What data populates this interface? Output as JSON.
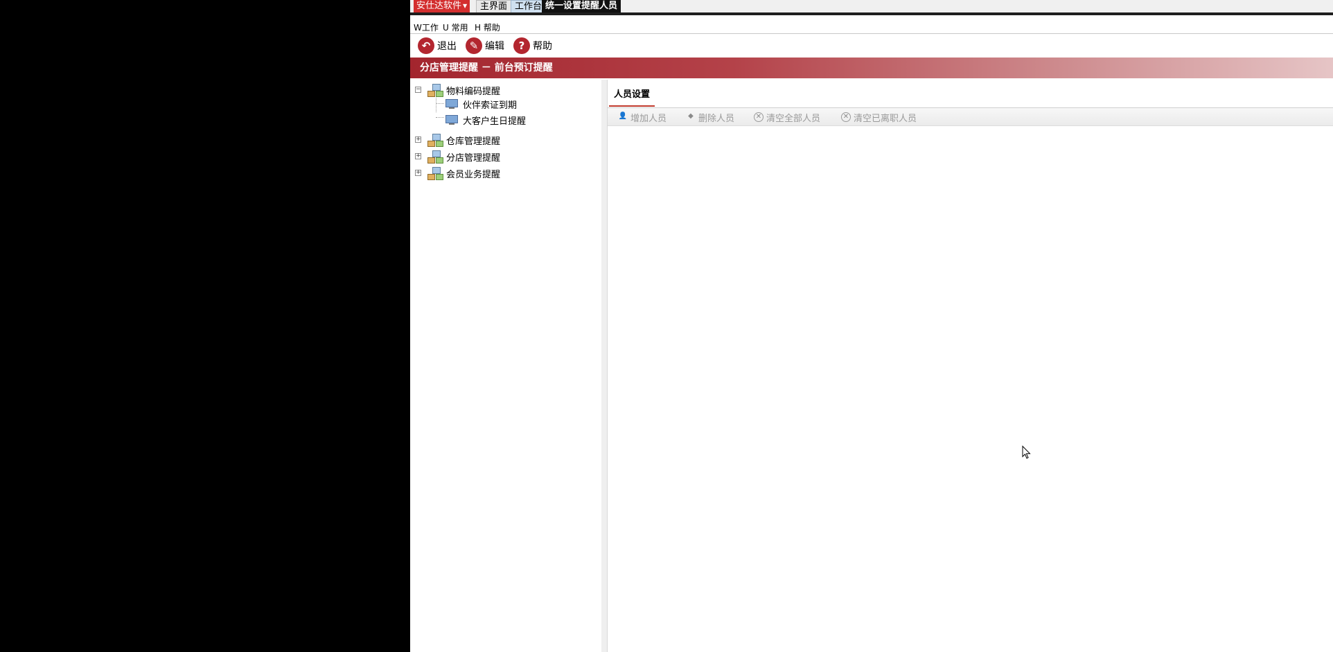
{
  "topbar": {
    "brand_label": "安仕达软件",
    "tabs": [
      {
        "label": "主界面"
      },
      {
        "label": "工作台"
      },
      {
        "label": "统一设置提醒人员"
      }
    ]
  },
  "menubar": {
    "items": [
      {
        "label": "W工作"
      },
      {
        "label": "U 常用"
      },
      {
        "label": "H 帮助"
      }
    ]
  },
  "toolbar": {
    "exit_label": "退出",
    "edit_label": "编辑",
    "help_label": "帮助"
  },
  "banner": {
    "title": "分店管理提醒 － 前台预订提醒"
  },
  "tree": {
    "nodes": [
      {
        "label": "物料编码提醒",
        "expanded": true,
        "children": [
          {
            "label": "伙伴索证到期"
          },
          {
            "label": "大客户生日提醒"
          }
        ]
      },
      {
        "label": "仓库管理提醒",
        "expanded": false
      },
      {
        "label": "分店管理提醒",
        "expanded": false
      },
      {
        "label": "会员业务提醒",
        "expanded": false
      }
    ]
  },
  "panel": {
    "tab_label": "人员设置",
    "buttons": [
      {
        "label": "增加人员",
        "icon": "add-person-icon"
      },
      {
        "label": "删除人员",
        "icon": "delete-person-icon"
      },
      {
        "label": "清空全部人员",
        "icon": "clear-all-icon"
      },
      {
        "label": "清空已离职人员",
        "icon": "clear-resigned-icon"
      }
    ]
  },
  "colors": {
    "accent_red": "#b3262f",
    "banner_start": "#a3252e",
    "banner_end": "#e6c5c6"
  }
}
